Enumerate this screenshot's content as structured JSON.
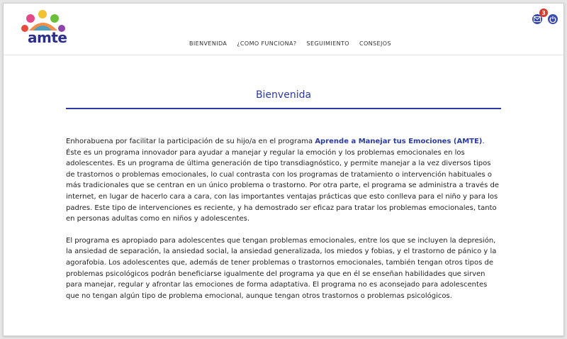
{
  "brand": {
    "logo_text": "amte"
  },
  "nav": [
    {
      "label": "BIENVENIDA"
    },
    {
      "label": "¿COMO FUNCIONA?"
    },
    {
      "label": "SEGUIMIENTO"
    },
    {
      "label": "CONSEJOS"
    }
  ],
  "header": {
    "mail_badge": "3"
  },
  "page": {
    "title": "Bienvenida",
    "p1_before": "Enhorabuena por facilitar la participación de su hijo/a en el programa ",
    "program_name": "Aprende a Manejar tus Emociones (AMTE)",
    "p1_after": ". Éste es un programa innovador para ayudar a manejar y regular la emoción y los problemas emocionales en los adolescentes. Es un programa de última generación de tipo transdiagnóstico, y permite manejar a la vez diversos tipos de trastornos o problemas emocionales, lo cual contrasta con los programas de tratamiento o intervención habituales o más tradicionales que se centran en un único problema o trastorno. Por otra parte, el programa se administra a través de internet, en lugar de hacerlo cara a cara, con las importantes ventajas prácticas que esto conlleva para el niño y para los padres. Este tipo de intervenciones es reciente, y ha demostrado ser eficaz para tratar los problemas emocionales, tanto en personas adultas como en niños y adolescentes.",
    "p2": "El programa es apropiado para adolescentes que tengan problemas emocionales, entre los que se incluyen la depresión, la ansiedad de separación, la ansiedad social, la ansiedad generalizada, los miedos y fobias, y el trastorno de pánico y la agorafobia. Los adolescentes que, además de tener problemas o trastornos emocionales, también tengan otros tipos de problemas psicológicos podrán beneficiarse igualmente del programa ya que en él se enseñan habilidades que sirven para manejar, regular y afrontar las emociones de forma adaptativa. El programa no es aconsejado para adolescentes que no tengan algún tipo de problema emocional, aunque tengan otros trastornos o problemas psicológicos."
  },
  "colors": {
    "accent": "#2b3b9e",
    "badge": "#d93a2b"
  },
  "icons": [
    "mail-icon",
    "power-icon"
  ]
}
